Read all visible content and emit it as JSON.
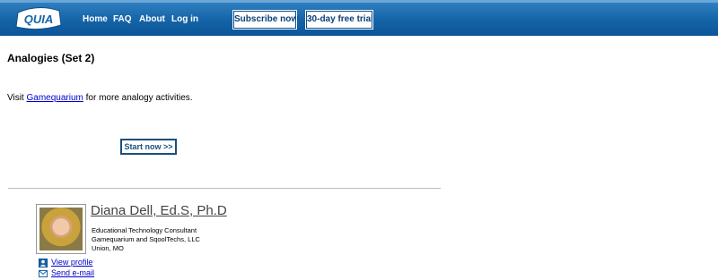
{
  "header": {
    "logo_text": "QUIA",
    "nav": [
      "Home",
      "FAQ",
      "About",
      "Log in"
    ],
    "subscribe_label": "Subscribe now",
    "trial_label": "30-day free trial"
  },
  "page": {
    "title": "Analogies (Set 2)",
    "visit_prefix": "Visit ",
    "visit_link": "Gamequarium",
    "visit_suffix": " for more analogy activities.",
    "start_label": "Start now >>"
  },
  "author": {
    "name": "Diana Dell, Ed.S, Ph.D",
    "role": "Educational Technology Consultant",
    "org": "Gamequarium and SqoolTechs, LLC",
    "location": "Union, MO",
    "profile_label": "View profile",
    "email_label": "Send e-mail"
  },
  "colors": {
    "header_blue": "#1565a8",
    "link_blue": "#0000cc"
  }
}
